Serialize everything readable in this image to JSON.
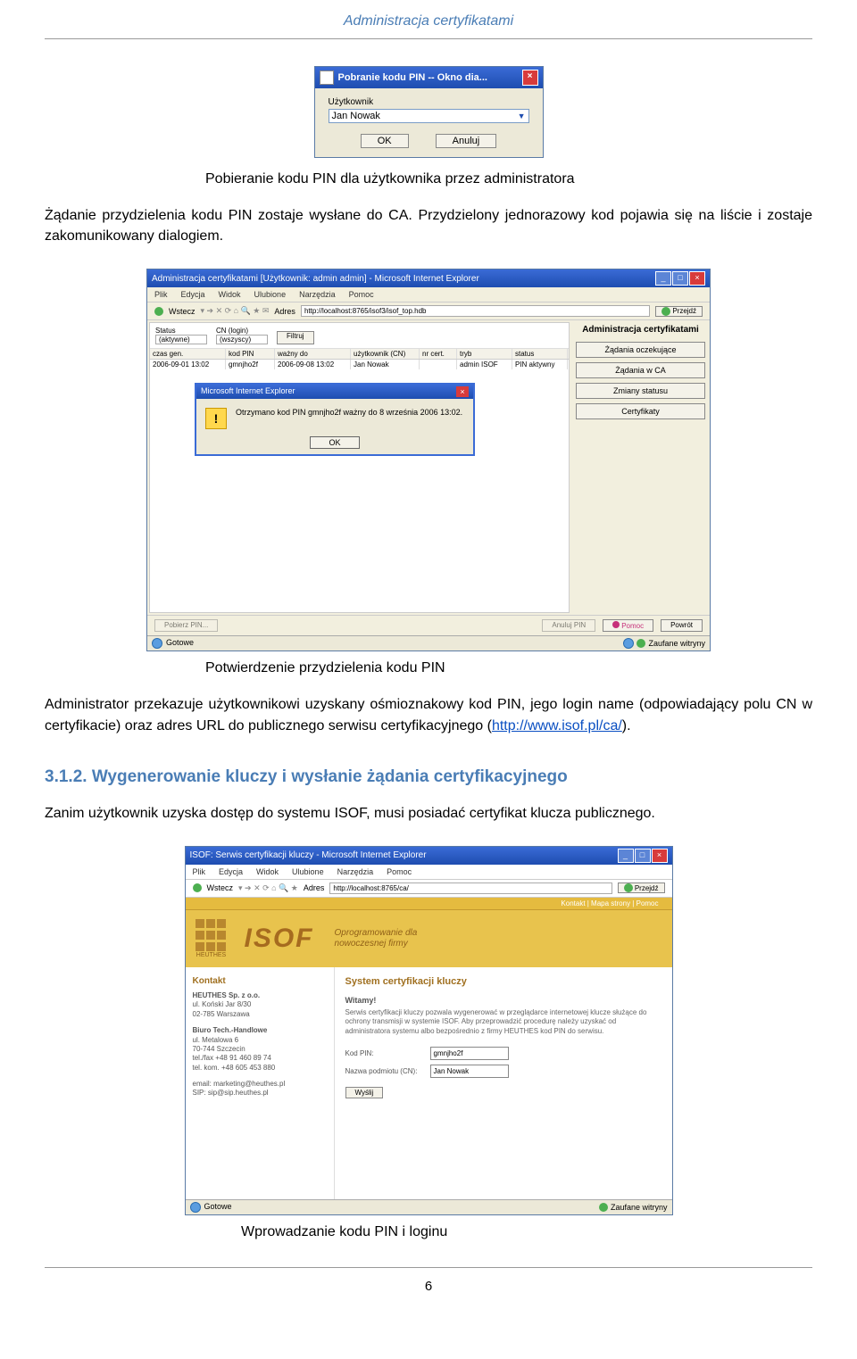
{
  "header": {
    "title": "Administracja certyfikatami"
  },
  "fig1": {
    "window_title": "Pobranie kodu PIN -- Okno dia...",
    "label_user": "Użytkownik",
    "value_user": "Jan Nowak",
    "ok": "OK",
    "cancel": "Anuluj",
    "caption": "Pobieranie kodu PIN dla użytkownika przez administratora"
  },
  "para1": "Żądanie przydzielenia kodu PIN zostaje wysłane do CA. Przydzielony jednorazowy kod pojawia się na liście i zostaje zakomunikowany dialogiem.",
  "fig2": {
    "ie_title": "Administracja certyfikatami [Użytkownik: admin admin] - Microsoft Internet Explorer",
    "menu": [
      "Plik",
      "Edycja",
      "Widok",
      "Ulubione",
      "Narzędzia",
      "Pomoc"
    ],
    "back": "Wstecz",
    "addr_label": "Adres",
    "url": "http://localhost:8765/isof3/isof_top.hdb",
    "go": "Przejdź",
    "filters": {
      "status_lbl": "Status",
      "status_val": "(aktywne)",
      "cn_lbl": "CN (login)",
      "cn_val": "(wszyscy)",
      "filter_btn": "Filtruj"
    },
    "table": {
      "headers": [
        "czas gen.",
        "kod PIN",
        "ważny do",
        "użytkownik (CN)",
        "nr cert.",
        "tryb",
        "status"
      ],
      "row": [
        "2006-09-01 13:02",
        "gmnjho2f",
        "2006-09-08 13:02",
        "Jan Nowak",
        "",
        "admin ISOF",
        "PIN aktywny"
      ]
    },
    "msgbox": {
      "title": "Microsoft Internet Explorer",
      "text": "Otrzymano kod PIN gmnjho2f ważny do 8 września 2006 13:02.",
      "ok": "OK"
    },
    "right": {
      "title": "Administracja certyfikatami",
      "b1": "Żądania oczekujące",
      "b2": "Żądania w CA",
      "b3": "Zmiany statusu",
      "b4": "Certyfikaty"
    },
    "bottom": {
      "pobierz": "Pobierz PIN...",
      "anuluj": "Anuluj PIN",
      "pomoc": "Pomoc",
      "powrot": "Powrót"
    },
    "status": {
      "left": "Gotowe",
      "right": "Zaufane witryny"
    },
    "caption": "Potwierdzenie przydzielenia kodu PIN"
  },
  "para2_a": "Administrator przekazuje użytkownikowi uzyskany ośmioznakowy kod PIN, jego login name (odpowiadający polu CN w certyfikacie) oraz adres URL do publicznego serwisu certyfikacyjnego (",
  "para2_link": "http://www.isof.pl/ca/",
  "para2_b": ").",
  "h3": "3.1.2. Wygenerowanie kluczy i wysłanie żądania certyfikacyjnego",
  "para3": "Zanim użytkownik uzyska dostęp do systemu ISOF, musi posiadać certyfikat klucza publicznego.",
  "fig3": {
    "ie_title": "ISOF: Serwis certyfikacji kluczy - Microsoft Internet Explorer",
    "menu": [
      "Plik",
      "Edycja",
      "Widok",
      "Ulubione",
      "Narzędzia",
      "Pomoc"
    ],
    "back": "Wstecz",
    "addr_label": "Adres",
    "url": "http://localhost:8765/ca/",
    "go": "Przejdź",
    "topnav": "Kontakt  |  Mapa strony  |  Pomoc",
    "brand": "ISOF",
    "brand_sub": "HEUTHES",
    "tagline_1": "Oprogramowanie dla",
    "tagline_2": "nowoczesnej firmy",
    "side": {
      "h": "Kontakt",
      "company": "HEUTHES Sp. z o.o.",
      "addr1": "ul. Koński Jar 8/30",
      "addr2": "02-785 Warszawa",
      "office": "Biuro Tech.-Handlowe",
      "addr3": "ul. Metalowa 6",
      "addr4": "70-744 Szczecin",
      "tel1": "tel./fax +48 91 460 89 74",
      "tel2": "tel. kom. +48 605 453 880",
      "email": "email: marketing@heuthes.pl",
      "sip": "SIP: sip@sip.heuthes.pl"
    },
    "main": {
      "h": "System certyfikacji kluczy",
      "welcome": "Witamy!",
      "desc": "Serwis certyfikacji kluczy pozwala wygenerować w przeglądarce internetowej klucze służące do ochrony transmisji w systemie ISOF. Aby przeprowadzić procedurę należy uzyskać od administratora systemu albo bezpośrednio z firmy HEUTHES kod PIN do serwisu.",
      "lbl_pin": "Kod PIN:",
      "val_pin": "gmnjho2f",
      "lbl_cn": "Nazwa podmiotu (CN):",
      "val_cn": "Jan Nowak",
      "send": "Wyślij"
    },
    "status": {
      "left": "Gotowe",
      "right": "Zaufane witryny"
    },
    "caption": "Wprowadzanie kodu PIN i loginu"
  },
  "page_number": "6"
}
